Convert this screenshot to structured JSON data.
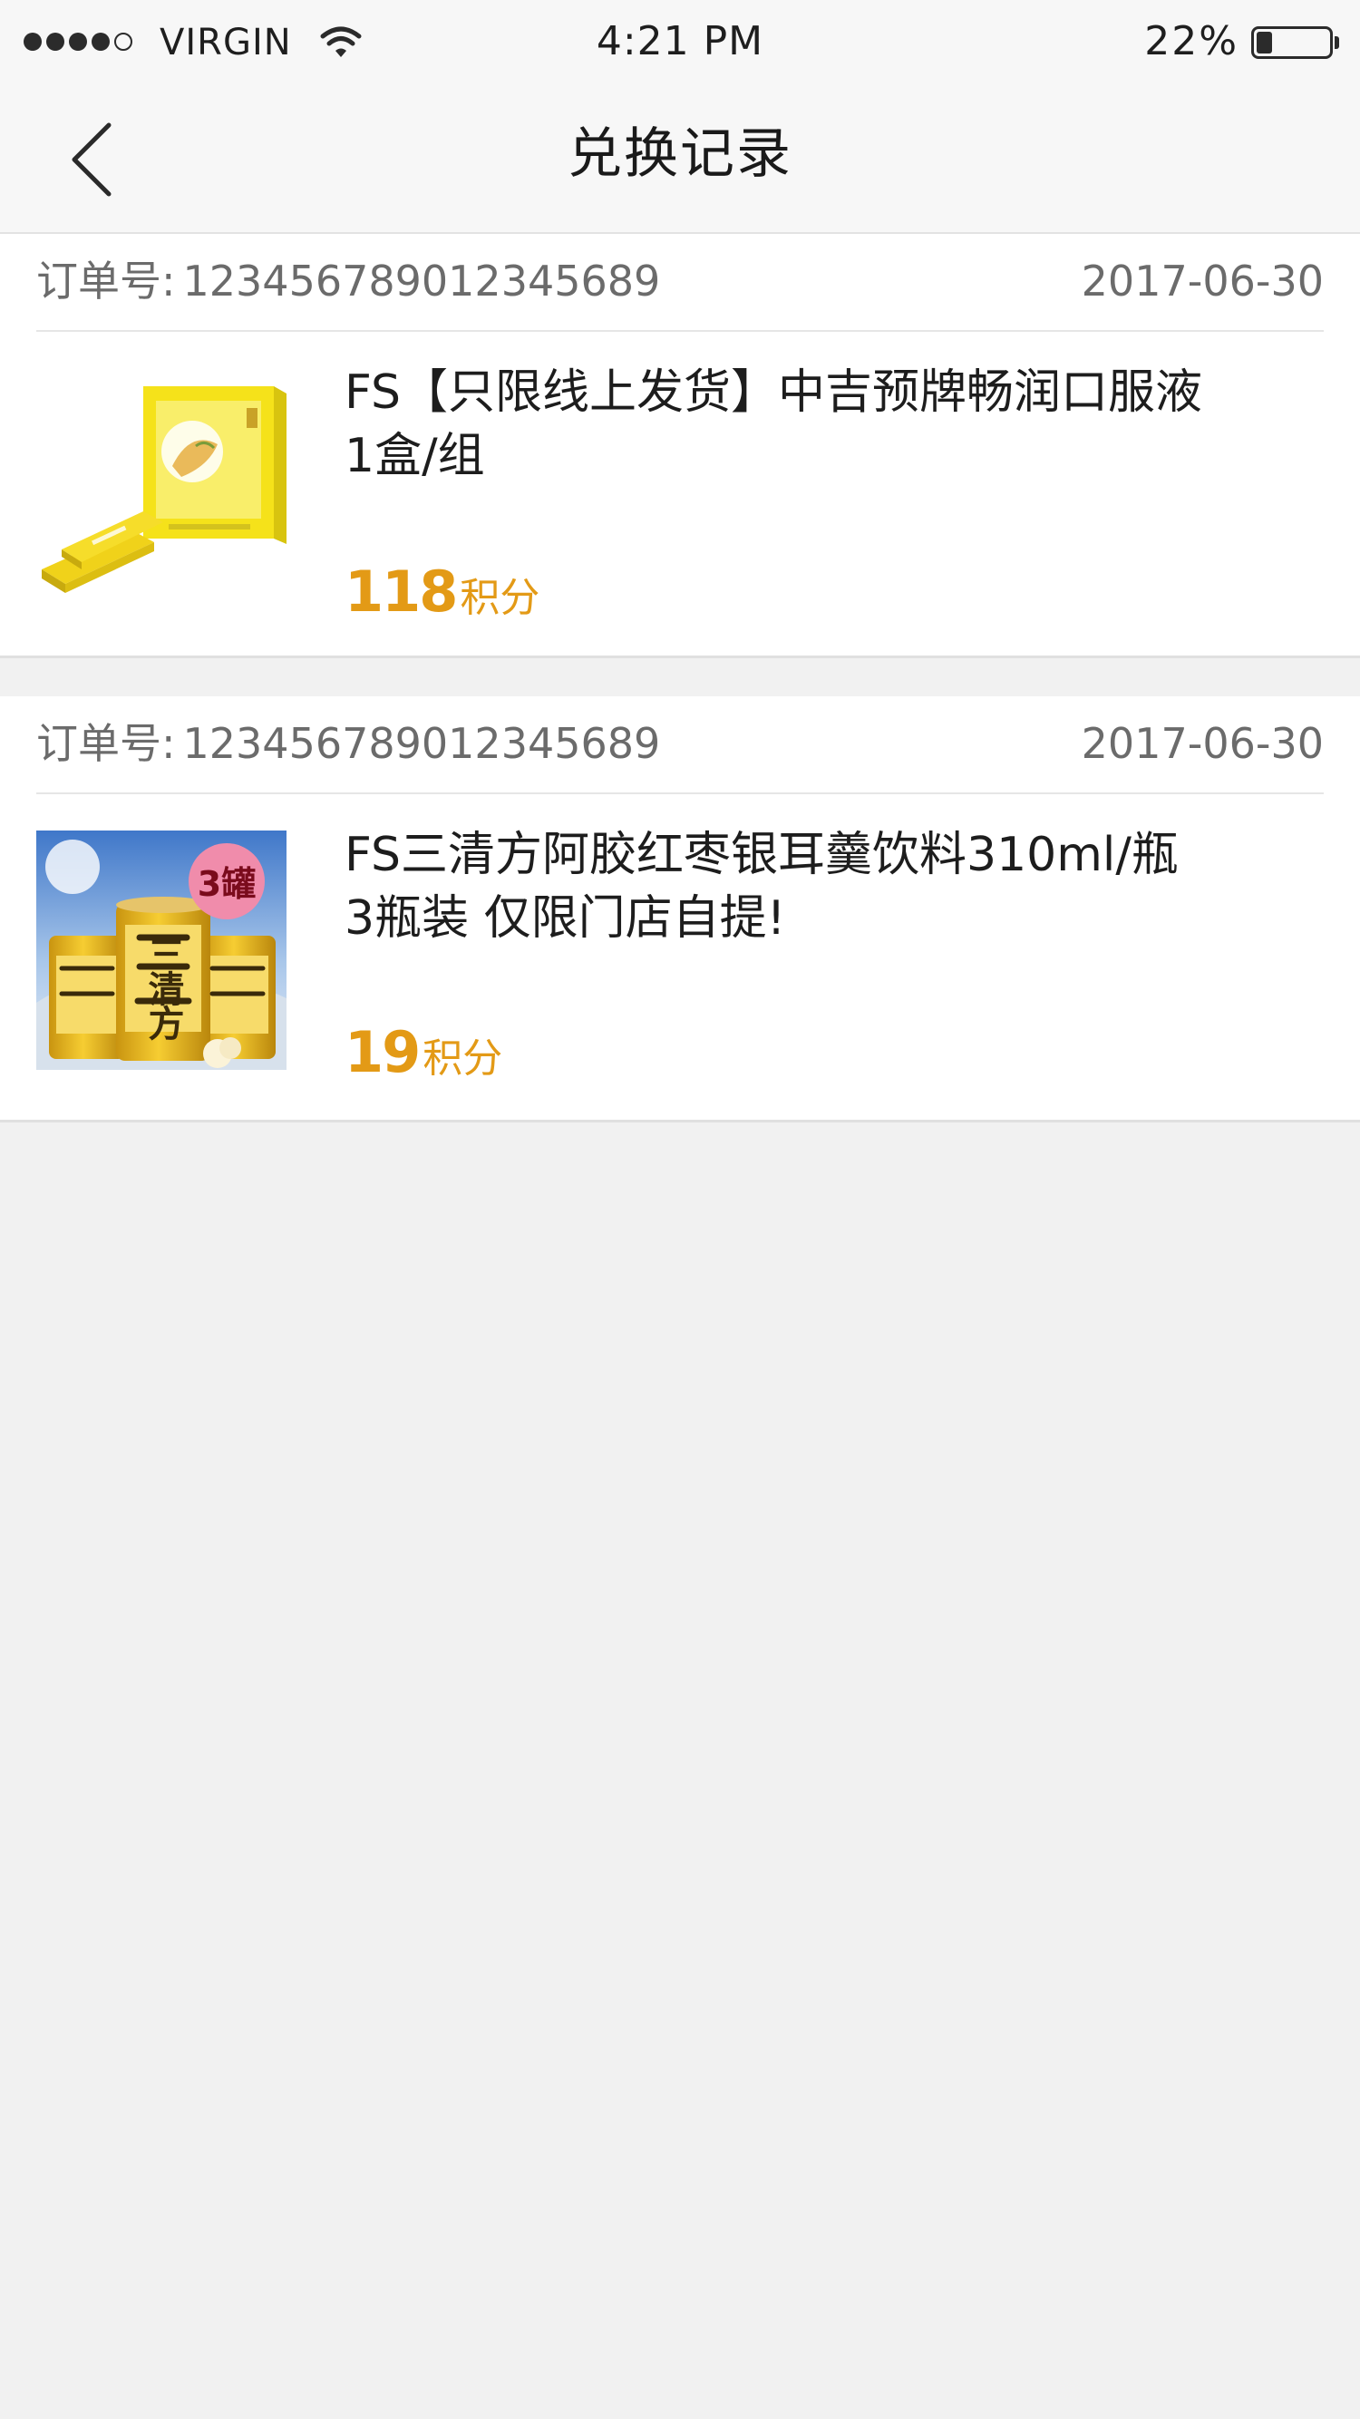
{
  "status_bar": {
    "carrier": "VIRGIN",
    "time": "4:21 PM",
    "battery_percent": "22%",
    "battery_level": 0.22,
    "signal_bars": 4,
    "signal_total": 5
  },
  "nav": {
    "title": "兑换记录",
    "back_icon": "chevron-left-icon"
  },
  "orders": [
    {
      "order_no_label": "订单号:",
      "order_no": "123456789012345689",
      "date": "2017-06-30",
      "product_name": "FS【只限线上发货】中吉预牌畅润口服液1盒/组",
      "points_value": "118",
      "points_unit": "积分",
      "image_icon": "product-box-image"
    },
    {
      "order_no_label": "订单号:",
      "order_no": "123456789012345689",
      "date": "2017-06-30",
      "product_name": "FS三清方阿胶红枣银耳羹饮料310ml/瓶 3瓶装 仅限门店自提!",
      "points_value": "19",
      "points_unit": "积分",
      "image_badge": "3罐",
      "image_can_text": "三清方",
      "image_icon": "drink-cans-image"
    }
  ],
  "colors": {
    "accent": "#e39a16",
    "background": "#f1f1f1",
    "card": "#ffffff",
    "bar": "#f7f7f7",
    "muted_text": "#6b6b6b",
    "badge": "#f08cab"
  }
}
